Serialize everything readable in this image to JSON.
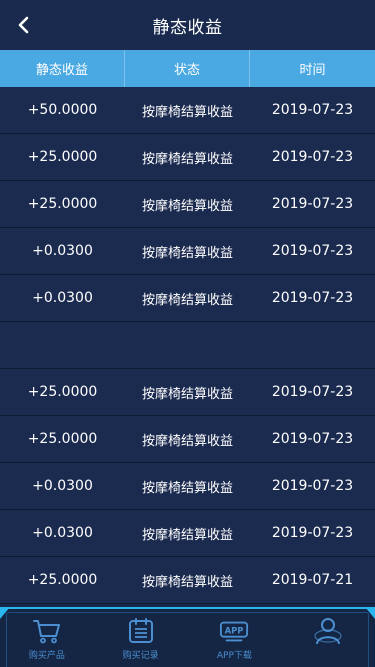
{
  "header": {
    "title": "静态收益",
    "back_icon": "chevron-left-icon"
  },
  "table": {
    "columns": [
      "静态收益",
      "状态",
      "时间"
    ],
    "rows": [
      {
        "amount": "+50.0000",
        "status": "按摩椅结算收益",
        "date": "2019-07-23"
      },
      {
        "amount": "+25.0000",
        "status": "按摩椅结算收益",
        "date": "2019-07-23"
      },
      {
        "amount": "+25.0000",
        "status": "按摩椅结算收益",
        "date": "2019-07-23"
      },
      {
        "amount": "+0.0300",
        "status": "按摩椅结算收益",
        "date": "2019-07-23"
      },
      {
        "amount": "+0.0300",
        "status": "按摩椅结算收益",
        "date": "2019-07-23"
      },
      {
        "amount": "",
        "status": "",
        "date": ""
      },
      {
        "amount": "+25.0000",
        "status": "按摩椅结算收益",
        "date": "2019-07-23"
      },
      {
        "amount": "+25.0000",
        "status": "按摩椅结算收益",
        "date": "2019-07-23"
      },
      {
        "amount": "+0.0300",
        "status": "按摩椅结算收益",
        "date": "2019-07-23"
      },
      {
        "amount": "+0.0300",
        "status": "按摩椅结算收益",
        "date": "2019-07-23"
      },
      {
        "amount": "+25.0000",
        "status": "按摩椅结算收益",
        "date": "2019-07-21"
      }
    ]
  },
  "tabbar": {
    "items": [
      {
        "label": "购买产品",
        "icon": "cart-icon"
      },
      {
        "label": "购买记录",
        "icon": "list-icon"
      },
      {
        "label": "APP下载",
        "icon": "app-download-icon",
        "icon_text": "APP"
      },
      {
        "label": "",
        "icon": "user-icon"
      }
    ]
  },
  "colors": {
    "background": "#192748",
    "header_bg": "#1a2a4e",
    "table_header_bg": "#4aa8e2",
    "row_divider": "#0f1a33",
    "tab_accent": "#2bb5ef",
    "tab_icon": "#4b8fd0"
  }
}
